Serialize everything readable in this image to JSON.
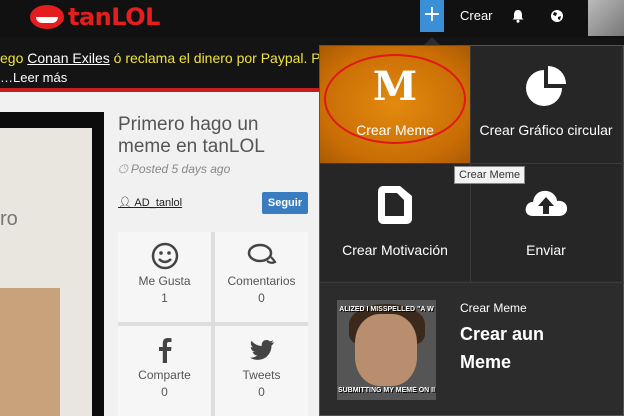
{
  "header": {
    "logo_text": "tanLOL",
    "plus_symbol": "+",
    "create_label": "Crear",
    "colors": {
      "logo": "#e41e1e",
      "plus_button": "#3a8fd6",
      "bar": "#111111"
    }
  },
  "announcement": {
    "prefix": "ego ",
    "game": "Conan Exiles",
    "middle": " ó reclama el dinero por Paypal. P",
    "read_more": "…Leer más"
  },
  "post": {
    "image_text": "ro",
    "title": "Primero hago un meme en tanLOL",
    "posted": "Posted 5 days ago",
    "author": "AD_tanlol",
    "follow_label": "Seguir",
    "stats": [
      {
        "icon": "smile-icon",
        "label": "Me Gusta",
        "value": "1"
      },
      {
        "icon": "comments-icon",
        "label": "Comentarios",
        "value": "0"
      },
      {
        "icon": "facebook-icon",
        "label": "Comparte",
        "value": "0"
      },
      {
        "icon": "twitter-icon",
        "label": "Tweets",
        "value": "0"
      }
    ]
  },
  "dropdown": {
    "tiles": [
      {
        "icon": "meme-m-icon",
        "glyph": "M",
        "label": "Crear Meme"
      },
      {
        "icon": "pie-chart-icon",
        "label": "Crear Gráfico circular"
      },
      {
        "icon": "motivation-frame-icon",
        "label": "Crear Motivación"
      },
      {
        "icon": "cloud-upload-icon",
        "label": "Enviar"
      }
    ],
    "recent": {
      "label": "Crear Meme",
      "title": "Crear aun Meme",
      "thumb_top": "ALIZED I MISSPELLED \"A W",
      "thumb_bottom": "SUBMITTING MY MEME ON II"
    },
    "tooltip": "Crear Meme",
    "colors": {
      "highlight": "#e38a0e",
      "annotation_circle": "#e01818",
      "panel": "#2c2c2c"
    }
  }
}
